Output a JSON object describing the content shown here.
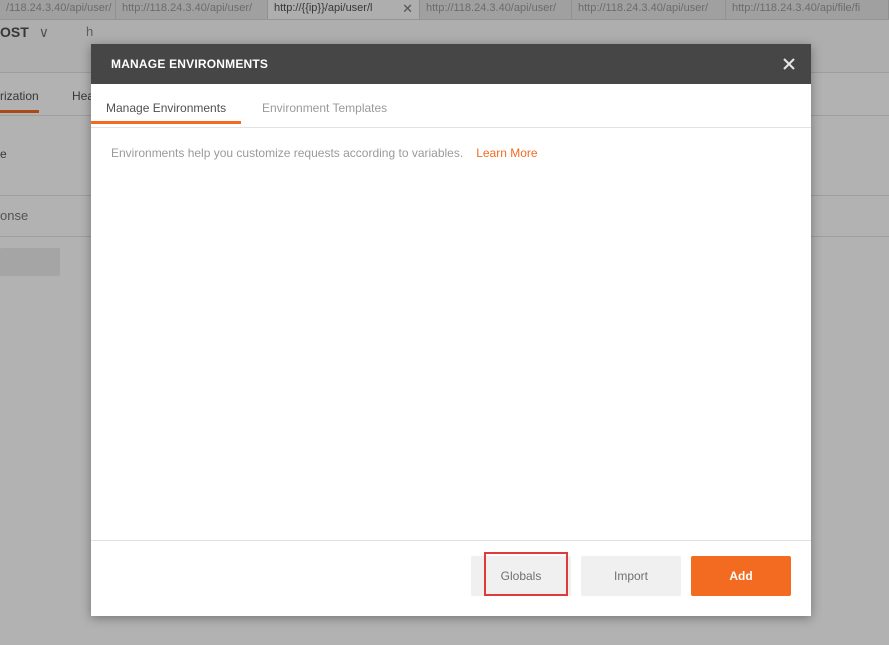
{
  "app_tabs": [
    {
      "label": "/118.24.3.40/api/user/"
    },
    {
      "label": "http://118.24.3.40/api/user/"
    },
    {
      "label": "http://{{ip}}/api/user/l",
      "active": true
    },
    {
      "label": "http://118.24.3.40/api/user/"
    },
    {
      "label": "http://118.24.3.40/api/user/"
    },
    {
      "label": "http://118.24.3.40/api/file/fi"
    }
  ],
  "request": {
    "method": "OST",
    "url_fragment": "h"
  },
  "subtabs": {
    "authorization": "rization",
    "headers": "Hea"
  },
  "background_text": {
    "line1": "e",
    "response": "onse"
  },
  "modal": {
    "title": "MANAGE ENVIRONMENTS",
    "tabs": [
      {
        "label": "Manage Environments",
        "active": true
      },
      {
        "label": "Environment Templates",
        "active": false
      }
    ],
    "help_text": "Environments help you customize requests according to variables.",
    "learn_more": "Learn More",
    "buttons": {
      "globals": "Globals",
      "import": "Import",
      "add": "Add"
    }
  },
  "colors": {
    "accent": "#f26b21",
    "header_bg": "#464646",
    "highlight": "#e03a3a"
  }
}
